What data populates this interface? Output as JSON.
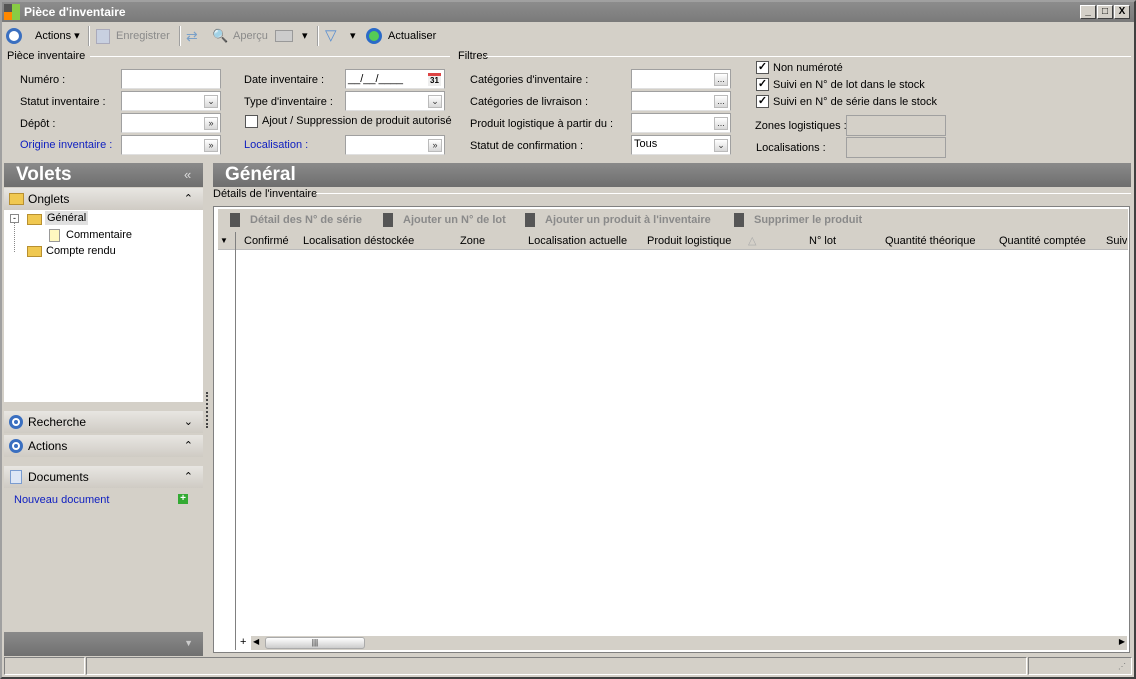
{
  "window": {
    "title": "Pièce d'inventaire",
    "minimize": "_",
    "maximize": "□",
    "close": "X"
  },
  "toolbar": {
    "actions": "Actions",
    "save": "Enregistrer",
    "preview": "Aperçu",
    "refresh": "Actualiser"
  },
  "piece": {
    "group": "Pièce inventaire",
    "numero": "Numéro :",
    "statut": "Statut inventaire :",
    "depot": "Dépôt :",
    "origine": "Origine inventaire :",
    "date": "Date inventaire :",
    "date_value": "__/__/____",
    "calendar": "31",
    "type": "Type d'inventaire :",
    "ajout": "Ajout / Suppression de produit autorisé",
    "localisation": "Localisation :"
  },
  "filtres": {
    "group": "Filtres",
    "cat_inv": "Catégories d'inventaire :",
    "cat_liv": "Catégories de livraison :",
    "produit": "Produit logistique à partir du :",
    "statut": "Statut de confirmation :",
    "statut_value": "Tous",
    "ellipsis": "...",
    "non_numerote": "Non numéroté",
    "suivi_lot": "Suivi en N° de lot dans le stock",
    "suivi_serie": "Suivi en N° de série dans le stock",
    "zones": "Zones logistiques :",
    "localisations": "Localisations :"
  },
  "volets": {
    "title": "Volets",
    "collapse": "«",
    "onglets": "Onglets",
    "tree": [
      "Général",
      "Commentaire",
      "Compte rendu"
    ],
    "recherche": "Recherche",
    "actions": "Actions",
    "documents": "Documents",
    "nouveau": "Nouveau document"
  },
  "main": {
    "title": "Général",
    "section": "Détails de l'inventaire",
    "buttons": [
      "Détail des N° de série",
      "Ajouter un N° de lot",
      "Ajouter un produit à l'inventaire",
      "Supprimer le produit"
    ],
    "columns": [
      "Confirmé",
      "Localisation déstockée",
      "Zone",
      "Localisation actuelle",
      "Produit logistique",
      "N° lot",
      "Quantité théorique",
      "Quantité comptée",
      "Suiv"
    ]
  }
}
